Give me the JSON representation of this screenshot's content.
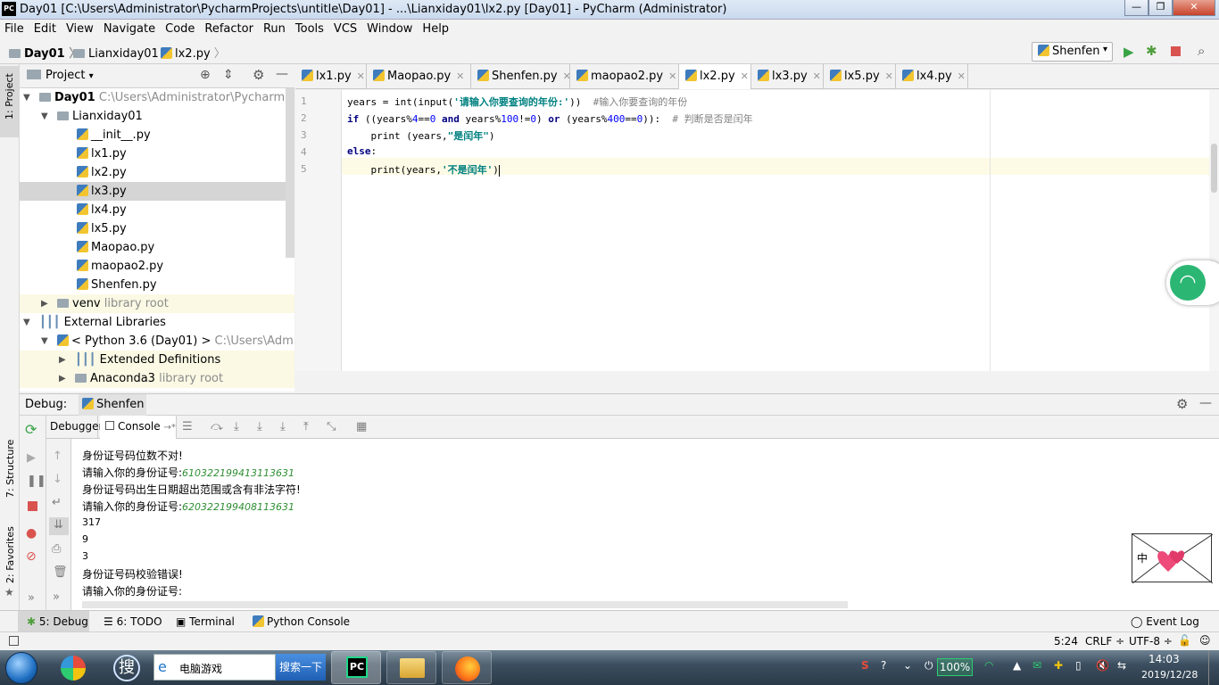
{
  "window": {
    "title": "Day01 [C:\\Users\\Administrator\\PycharmProjects\\untitle\\Day01] - ...\\Lianxiday01\\lx2.py [Day01] - PyCharm (Administrator)",
    "app_icon": "PC",
    "minimize": "—",
    "maximize": "❐",
    "close": "✕"
  },
  "menu": [
    "File",
    "Edit",
    "View",
    "Navigate",
    "Code",
    "Refactor",
    "Run",
    "Tools",
    "VCS",
    "Window",
    "Help"
  ],
  "breadcrumb": [
    "Day01",
    "Lianxiday01",
    "lx2.py"
  ],
  "run_config": "Shenfen",
  "left_stripe": {
    "project": "1: Project",
    "structure": "7: Structure",
    "favorites": "2: Favorites"
  },
  "project_panel": {
    "title": "Project",
    "tree": [
      {
        "label": "Day01",
        "suffix": "C:\\Users\\Administrator\\PycharmProjec"
      },
      {
        "label": "Lianxiday01"
      },
      {
        "label": "__init__.py"
      },
      {
        "label": "lx1.py"
      },
      {
        "label": "lx2.py"
      },
      {
        "label": "lx3.py"
      },
      {
        "label": "lx4.py"
      },
      {
        "label": "lx5.py"
      },
      {
        "label": "Maopao.py"
      },
      {
        "label": "maopao2.py"
      },
      {
        "label": "Shenfen.py"
      },
      {
        "label": "venv",
        "suffix": "library root"
      },
      {
        "label": "External Libraries"
      },
      {
        "label": "< Python 3.6 (Day01) >",
        "suffix": "C:\\Users\\Administr"
      },
      {
        "label": "Extended Definitions"
      },
      {
        "label": "Anaconda3",
        "suffix": "library root"
      }
    ]
  },
  "editor_tabs": [
    "lx1.py",
    "Maopao.py",
    "Shenfen.py",
    "maopao2.py",
    "lx2.py",
    "lx3.py",
    "lx5.py",
    "lx4.py"
  ],
  "active_tab": "lx2.py",
  "code": {
    "line_numbers": [
      "1",
      "2",
      "3",
      "4",
      "5"
    ],
    "line1": {
      "a": "years = int(input(",
      "s": "'请输入你要查询的年份:'",
      "b": "))  ",
      "c": "#输入你要查询的年份"
    },
    "line2": {
      "kw": "if",
      "a": " ((years%",
      "n1": "4",
      "b": "==",
      "n2": "0",
      "c": " ",
      "and": "and",
      "d": " years%",
      "n3": "100",
      "e": "!=",
      "n4": "0",
      "f": ") ",
      "or": "or",
      "g": " (years%",
      "n5": "400",
      "h": "==",
      "n6": "0",
      "i": ")):  ",
      "cmt": "# 判断是否是闰年"
    },
    "line3": {
      "a": "    print (years,",
      "s": "\"是闰年\"",
      "b": ")"
    },
    "line4": {
      "kw": "else",
      "a": ":"
    },
    "line5": {
      "a": "    print(years,",
      "s": "'不是闰年'",
      "b": ")"
    }
  },
  "debug": {
    "label": "Debug:",
    "config": "Shenfen",
    "tabs": [
      "Debugger",
      "Console"
    ],
    "console_lines": [
      {
        "text": "身份证号码位数不对!"
      },
      {
        "text": "请输入你的身份证号:",
        "input": "610322199413113631"
      },
      {
        "text": "身份证号码出生日期超出范围或含有非法字符!"
      },
      {
        "text": "请输入你的身份证号:",
        "input": "620322199408113631"
      },
      {
        "text": "317"
      },
      {
        "text": "9"
      },
      {
        "text": "3"
      },
      {
        "text": "身份证号码校验错误!"
      },
      {
        "text": "请输入你的身份证号:"
      }
    ]
  },
  "bottom_tools": [
    "5: Debug",
    "6: TODO",
    "Terminal",
    "Python Console",
    "Event Log"
  ],
  "status": {
    "position": "5:24",
    "line_sep": "CRLF ÷",
    "encoding": "UTF-8 ÷"
  },
  "taskbar": {
    "search_text": "电脑游戏",
    "search_button": "搜索一下",
    "battery": "100%",
    "time": "14:03",
    "date": "2019/12/28"
  },
  "envelope_text": "中"
}
